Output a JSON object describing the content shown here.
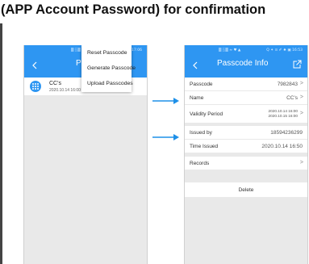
{
  "heading": "(APP Account Password) for confirmation",
  "phone_left": {
    "status_left": "▒ ░▒ ≈ ♥ ▲",
    "status_right": "Q ✦ ⊙ ✐ ♠ ▣ 17:06",
    "title_fragment": "Pas",
    "list_item": {
      "name": "CC's",
      "date": "2020.10.14 16:00"
    },
    "menu": [
      "Reset Passcode",
      "Generate Passcode",
      "Upload Passcodes"
    ]
  },
  "phone_right": {
    "status_left": "▒ ░▒ ≈ ♥ ▲",
    "status_right": "Q ✦ ⊙ ✐ ♠ ▣ 16:53",
    "title": "Passcode Info",
    "rows": [
      {
        "label": "Passcode",
        "value": "7982843",
        "chevron": ">"
      },
      {
        "label": "Name",
        "value": "CC's",
        "chevron": ">"
      },
      {
        "label": "Validity Period",
        "value_line1": "2020.10.14 16:00",
        "value_line2": "2020.10.15 16:00",
        "chevron": ">"
      },
      {
        "label": "Issued by",
        "value": "18594236299"
      },
      {
        "label": "Time Issued",
        "value": "2020.10.14 16:50"
      },
      {
        "label": "Records",
        "chevron": ">"
      }
    ],
    "delete_label": "Delete"
  },
  "colors": {
    "accent": "#2e96f2",
    "arrow": "#1e90e8"
  }
}
